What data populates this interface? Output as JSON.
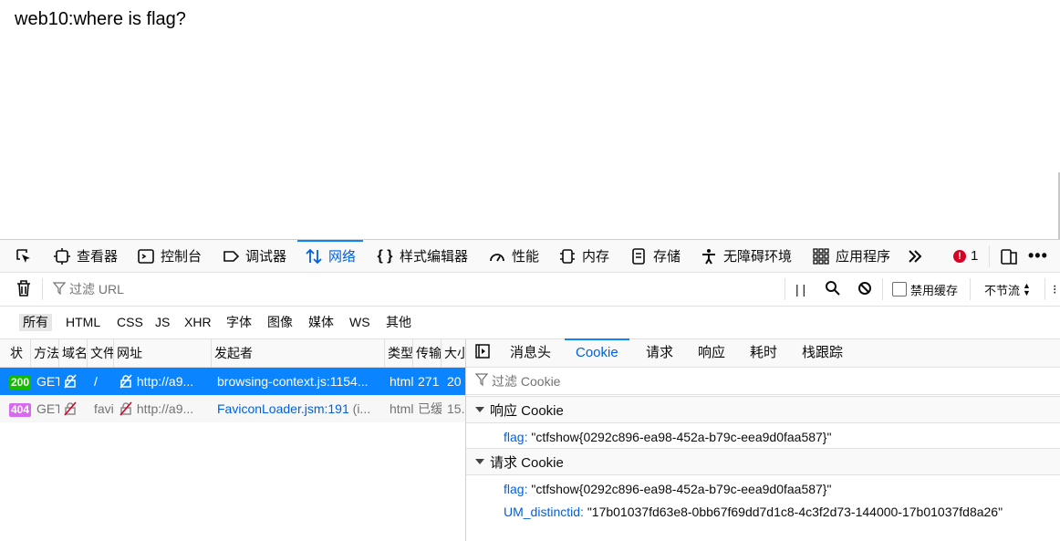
{
  "page": {
    "heading": "web10:where is flag?"
  },
  "devtools": {
    "tools": [
      {
        "label": "",
        "icon": "pick-element-icon"
      },
      {
        "label": "查看器",
        "icon": "inspector-icon"
      },
      {
        "label": "控制台",
        "icon": "console-icon"
      },
      {
        "label": "调试器",
        "icon": "debugger-icon"
      },
      {
        "label": "网络",
        "icon": "network-icon",
        "active": true
      },
      {
        "label": "样式编辑器",
        "icon": "style-editor-icon"
      },
      {
        "label": "性能",
        "icon": "performance-icon"
      },
      {
        "label": "内存",
        "icon": "memory-icon"
      },
      {
        "label": "存储",
        "icon": "storage-icon"
      },
      {
        "label": "无障碍环境",
        "icon": "accessibility-icon"
      },
      {
        "label": "应用程序",
        "icon": "application-icon"
      }
    ],
    "error_count": "1",
    "network_toolbar": {
      "filter_placeholder": "过滤 URL",
      "pause_label": "| |",
      "disable_cache_label": "禁用缓存",
      "throttle_label": "不节流"
    },
    "type_filters": [
      "所有",
      "HTML",
      "CSS",
      "JS",
      "XHR",
      "字体",
      "图像",
      "媒体",
      "WS",
      "其他"
    ],
    "columns": [
      "状",
      "方法",
      "域名",
      "文件",
      "网址",
      "发起者",
      "类型",
      "传输",
      "大小"
    ],
    "requests": [
      {
        "status": "200",
        "method": "GET",
        "domain": "",
        "file": "/",
        "url": "http://a9...",
        "initiator": "browsing-context.js:1154...",
        "type": "html",
        "transferred": "271",
        "size": "20"
      },
      {
        "status": "404",
        "method": "GET",
        "domain": "",
        "file": "favi",
        "url": "http://a9...",
        "initiator": "FaviconLoader.jsm:191",
        "initiator_suffix": " (i...",
        "type": "html",
        "transferred": "已缓",
        "size": "15."
      }
    ],
    "side_tabs": [
      "消息头",
      "Cookie",
      "请求",
      "响应",
      "耗时",
      "栈跟踪"
    ],
    "cookie_filter_placeholder": "过滤 Cookie",
    "response_cookies": {
      "title": "响应 Cookie",
      "items": [
        {
          "key": "flag",
          "value": "\"ctfshow{0292c896-ea98-452a-b79c-eea9d0faa587}\""
        }
      ]
    },
    "request_cookies": {
      "title": "请求 Cookie",
      "items": [
        {
          "key": "flag",
          "value": "\"ctfshow{0292c896-ea98-452a-b79c-eea9d0faa587}\""
        },
        {
          "key": "UM_distinctid",
          "value": "\"17b01037fd63e8-0bb67f69dd7d1c8-4c3f2d73-144000-17b01037fd8a26\""
        }
      ]
    },
    "colors": {
      "accent": "#0a84ff",
      "link": "#0060df",
      "ok_status": "#12bc00",
      "notfound_status": "#d96af0",
      "error": "#d70022"
    }
  }
}
